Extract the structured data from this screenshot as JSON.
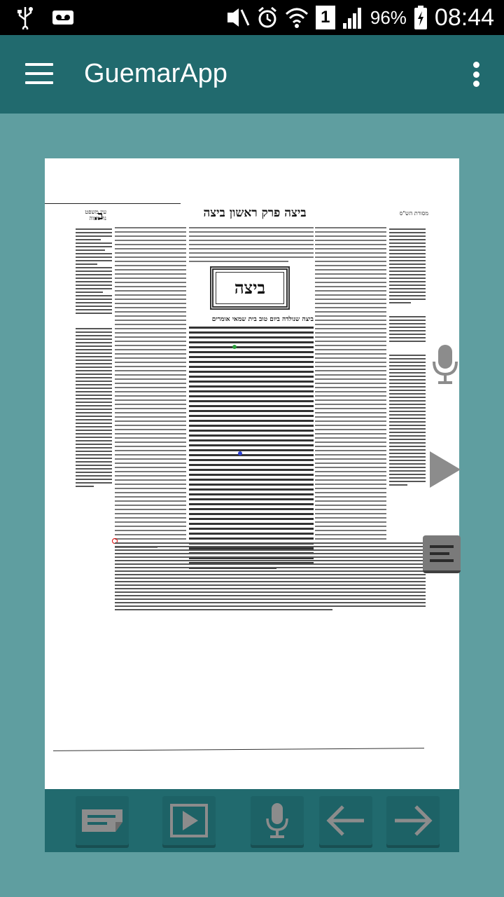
{
  "status_bar": {
    "battery_percent": "96%",
    "time": "08:44",
    "sim_label": "1",
    "icons": [
      "usb-icon",
      "voicemail-icon",
      "mute-vibrate-icon",
      "alarm-icon",
      "wifi-icon",
      "sim-icon",
      "signal-icon",
      "battery-charging-icon"
    ]
  },
  "app_bar": {
    "title": "GuemarApp",
    "menu_icon": "hamburger-menu-icon",
    "overflow_icon": "more-vert-icon"
  },
  "page_view": {
    "masechet_title": "ביצה",
    "header_center": "ביצה פרק ראשון ביצה",
    "header_left": "ב.",
    "header_left_small": "עין משפט\nנר מצוה",
    "header_right_small": "מסורת הש\"ס",
    "opening_words": "ביצה שנולדה ביום טוב בית שמאי אומרים"
  },
  "overlay_buttons": {
    "mic": "microphone-icon",
    "play": "play-icon",
    "note": "note-icon"
  },
  "toolbar": {
    "buttons": [
      {
        "name": "note-button",
        "icon": "note-icon"
      },
      {
        "name": "play-button",
        "icon": "play-icon"
      },
      {
        "name": "mic-button",
        "icon": "microphone-icon"
      },
      {
        "name": "back-button",
        "icon": "arrow-left-icon"
      },
      {
        "name": "forward-button",
        "icon": "arrow-right-icon"
      }
    ]
  },
  "colors": {
    "app_bar": "#216a6e",
    "background": "#5f9ea0",
    "status_bar": "#000000"
  }
}
